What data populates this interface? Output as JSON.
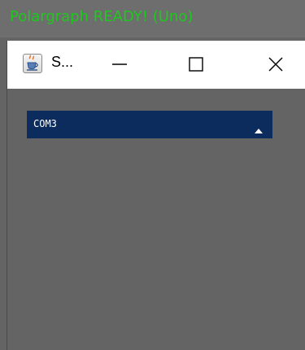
{
  "background": {
    "banner_text": "Polargraph READY! (Uno)",
    "banner_color": "#1ec81e"
  },
  "window": {
    "title": "S...",
    "app_icon": "java-cup-icon",
    "controls": {
      "minimize_icon": "minimize-icon",
      "maximize_icon": "maximize-icon",
      "close_icon": "close-icon"
    }
  },
  "serial_port": {
    "selected": "COM3",
    "arrow_icon": "caret-up-icon",
    "accent_color": "#0b2c5c"
  },
  "colors": {
    "panel_background": "#646464",
    "titlebar_background": "#ffffff"
  }
}
